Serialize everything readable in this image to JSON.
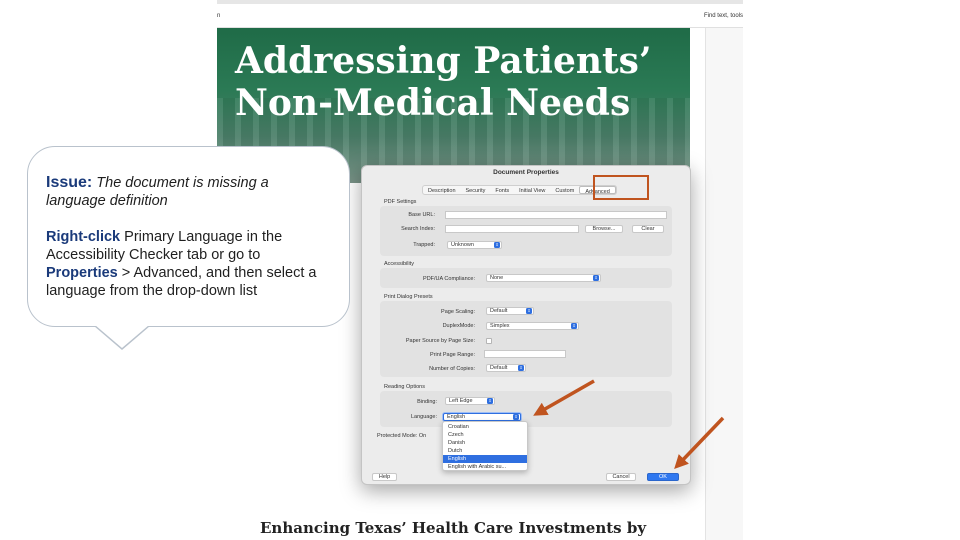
{
  "viewer": {
    "toolbar_left": "n",
    "toolbar_right": "Find text, tools"
  },
  "document": {
    "banner_title_line1": "Addressing Patients’",
    "banner_title_line2": "Non-Medical Needs",
    "bottom_heading": "Enhancing Texas’ Health Care Investments by"
  },
  "callout": {
    "issue_label": "Issue:",
    "issue_text": "The document is missing a language definition",
    "step_bold1": "Right-click",
    "step_text1": " Primary Language in the Accessibility Checker tab or go to ",
    "step_bold2": "Properties",
    "step_text2": " > Advanced, and then select a language from the drop-down list"
  },
  "dialog": {
    "title": "Document Properties",
    "tabs": [
      "Description",
      "Security",
      "Fonts",
      "Initial View",
      "Custom",
      "Advanced"
    ],
    "active_tab": "Advanced",
    "pdf_settings": {
      "title": "PDF Settings",
      "base_url_label": "Base URL:",
      "search_index_label": "Search Index:",
      "browse_label": "Browse...",
      "clear_label": "Clear",
      "trapped_label": "Trapped:",
      "trapped_value": "Unknown"
    },
    "accessibility": {
      "title": "Accessibility",
      "pdfua_label": "PDF/UA Compliance:",
      "pdfua_value": "None"
    },
    "print_presets": {
      "title": "Print Dialog Presets",
      "page_scaling_label": "Page Scaling:",
      "page_scaling_value": "Default",
      "duplex_label": "DuplexMode:",
      "duplex_value": "Simplex",
      "paper_source_label": "Paper Source by Page Size:",
      "page_range_label": "Print Page Range:",
      "copies_label": "Number of Copies:",
      "copies_value": "Default"
    },
    "reading": {
      "title": "Reading Options",
      "binding_label": "Binding:",
      "binding_value": "Left Edge",
      "language_label": "Language:",
      "language_value": "English",
      "language_options": [
        "Croatian",
        "Czech",
        "Danish",
        "Dutch",
        "English",
        "English with Arabic su..."
      ],
      "selected_option": "English"
    },
    "protected_mode_label": "Protected Mode:",
    "protected_mode_value": "On",
    "help_label": "Help",
    "cancel_label": "Cancel",
    "ok_label": "OK"
  },
  "colors": {
    "accent_orange": "#c0541f",
    "callout_heading_blue": "#1a3a7a",
    "mac_blue": "#2f6fe0",
    "banner_green": "#2b7a55"
  }
}
